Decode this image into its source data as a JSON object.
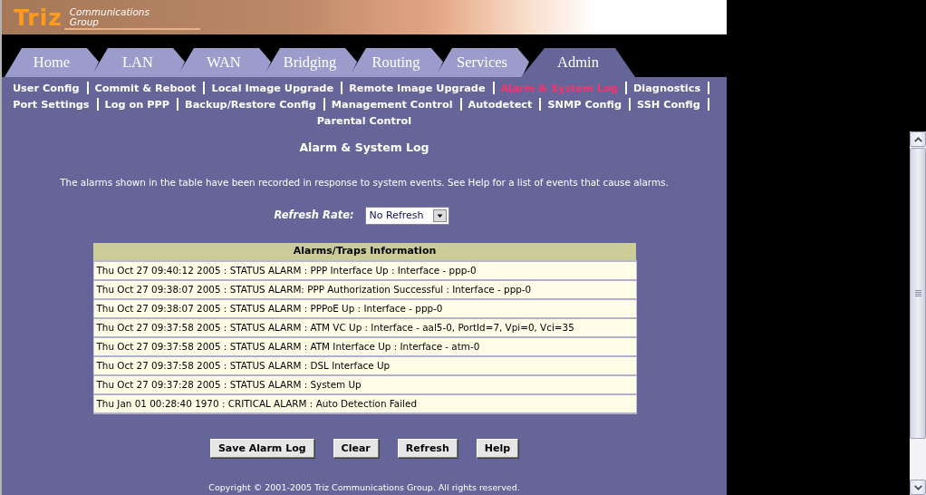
{
  "banner": {
    "logo": "Triz",
    "tagline": [
      "Communications",
      "Group"
    ]
  },
  "tabs": [
    {
      "label": "Home",
      "selected": false
    },
    {
      "label": "LAN",
      "selected": false
    },
    {
      "label": "WAN",
      "selected": false
    },
    {
      "label": "Bridging",
      "selected": false
    },
    {
      "label": "Routing",
      "selected": false
    },
    {
      "label": "Services",
      "selected": false
    },
    {
      "label": "Admin",
      "selected": true
    }
  ],
  "sub_nav": [
    {
      "label": "User Config",
      "selected": false
    },
    {
      "label": "Commit & Reboot",
      "selected": false
    },
    {
      "label": "Local Image Upgrade",
      "selected": false
    },
    {
      "label": "Remote Image Upgrade",
      "selected": false
    },
    {
      "label": "Alarm & System Log",
      "selected": true
    },
    {
      "label": "Diagnostics",
      "selected": false
    },
    {
      "label": "Port Settings",
      "selected": false
    },
    {
      "label": "Log on PPP",
      "selected": false
    },
    {
      "label": "Backup/Restore Config",
      "selected": false
    },
    {
      "label": "Management Control",
      "selected": false
    },
    {
      "label": "Autodetect",
      "selected": false
    },
    {
      "label": "SNMP Config",
      "selected": false
    },
    {
      "label": "SSH Config",
      "selected": false
    },
    {
      "label": "Parental Control",
      "selected": false
    }
  ],
  "page": {
    "title": "Alarm & System Log",
    "description": "The alarms shown in the table have been recorded in response to system events. See Help for a list of events that cause alarms."
  },
  "refresh_rate": {
    "label": "Refresh Rate:",
    "value": "No Refresh"
  },
  "table": {
    "columns": [
      "Alarms/Traps Information"
    ],
    "rows": [
      "Thu Oct 27 09:40:12 2005 : STATUS ALARM : PPP Interface Up : Interface - ppp-0",
      "Thu Oct 27 09:38:07 2005 : STATUS ALARM: PPP Authorization Successful : Interface - ppp-0",
      "Thu Oct 27 09:38:07 2005 : STATUS ALARM : PPPoE Up : Interface - ppp-0",
      "Thu Oct 27 09:37:58 2005 : STATUS ALARM : ATM VC Up : Interface - aal5-0, PortId=7, Vpi=0, Vci=35",
      "Thu Oct 27 09:37:58 2005 : STATUS ALARM : ATM Interface Up : Interface - atm-0",
      "Thu Oct 27 09:37:58 2005 : STATUS ALARM : DSL Interface Up",
      "Thu Oct 27 09:37:28 2005 : STATUS ALARM : System Up",
      "Thu Jan 01 00:28:40 1970 : CRITICAL ALARM : Auto Detection Failed"
    ]
  },
  "buttons": [
    "Save Alarm Log",
    "Clear",
    "Refresh",
    "Help"
  ],
  "footer": {
    "copyright": "Copyright © 2001-2005 Triz Communications Group. All rights reserved."
  }
}
